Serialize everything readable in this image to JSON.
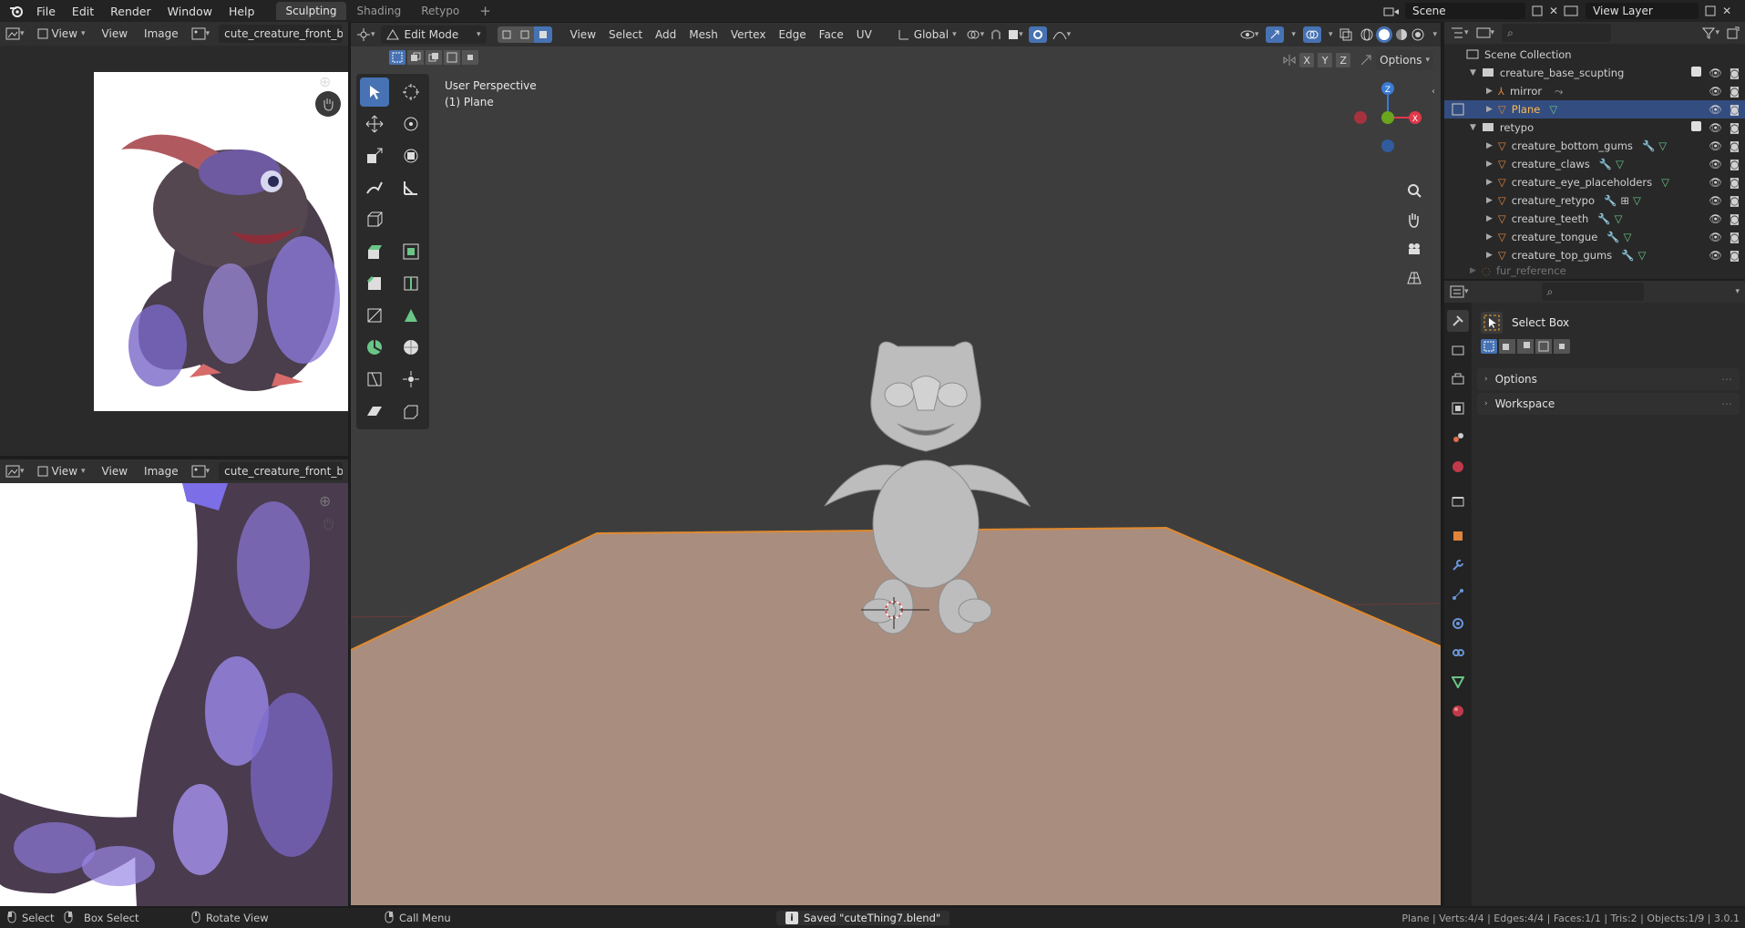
{
  "topbar": {
    "menus": [
      "File",
      "Edit",
      "Render",
      "Window",
      "Help"
    ],
    "workspaces": [
      {
        "label": "Sculpting",
        "active": true
      },
      {
        "label": "Shading",
        "active": false
      },
      {
        "label": "Retypo",
        "active": false
      }
    ],
    "add_tab": "+",
    "scene_name": "Scene",
    "view_layer": "View Layer"
  },
  "image_editor_top": {
    "view_label": "View",
    "menus": [
      "View",
      "Image"
    ],
    "image_name": "cute_creature_front_back..."
  },
  "image_editor_bottom": {
    "view_label": "View",
    "menus": [
      "View",
      "Image"
    ],
    "image_name": "cute_creature_front_back..."
  },
  "viewport": {
    "mode": "Edit Mode",
    "menus": [
      "View",
      "Select",
      "Add",
      "Mesh",
      "Vertex",
      "Edge",
      "Face",
      "UV"
    ],
    "transform_orientation": "Global",
    "options_label": "Options",
    "axis_locks": [
      "X",
      "Y",
      "Z"
    ],
    "perspective_label": "User Perspective",
    "object_label": "(1) Plane",
    "gizmo_axes": {
      "x": "X",
      "y": "Y",
      "z": "Z"
    },
    "colors": {
      "x": "#e0384a",
      "y": "#6aa51d",
      "z": "#3a7bd5",
      "floor": "#a88b7b",
      "selection_outline": "#e08a2f"
    }
  },
  "outliner": {
    "root": "Scene Collection",
    "rows": [
      {
        "label": "creature_base_scupting",
        "type": "collection",
        "indent": 1,
        "expanded": true,
        "checked": true
      },
      {
        "label": "mirror",
        "type": "empty",
        "indent": 2,
        "expanded": false
      },
      {
        "label": "Plane",
        "type": "mesh",
        "indent": 2,
        "selected": true
      },
      {
        "label": "retypo",
        "type": "collection",
        "indent": 1,
        "expanded": true,
        "checked": true
      },
      {
        "label": "creature_bottom_gums",
        "type": "mesh",
        "indent": 2
      },
      {
        "label": "creature_claws",
        "type": "mesh",
        "indent": 2
      },
      {
        "label": "creature_eye_placeholders",
        "type": "mesh",
        "indent": 2
      },
      {
        "label": "creature_retypo",
        "type": "mesh",
        "indent": 2
      },
      {
        "label": "creature_teeth",
        "type": "mesh",
        "indent": 2
      },
      {
        "label": "creature_tongue",
        "type": "mesh",
        "indent": 2
      },
      {
        "label": "creature_top_gums",
        "type": "mesh",
        "indent": 2
      },
      {
        "label": "fur_reference",
        "type": "mesh",
        "indent": 1,
        "faded": true
      }
    ]
  },
  "properties": {
    "tool_name": "Select Box",
    "sections": [
      "Options",
      "Workspace"
    ]
  },
  "status": {
    "select": "Select",
    "box_select": "Box Select",
    "rotate_view": "Rotate View",
    "call_menu": "Call Menu",
    "message": "Saved \"cuteThing7.blend\"",
    "stats": "Plane | Verts:4/4 | Edges:4/4 | Faces:1/1 | Tris:2 | Objects:1/9 | 3.0.1"
  }
}
